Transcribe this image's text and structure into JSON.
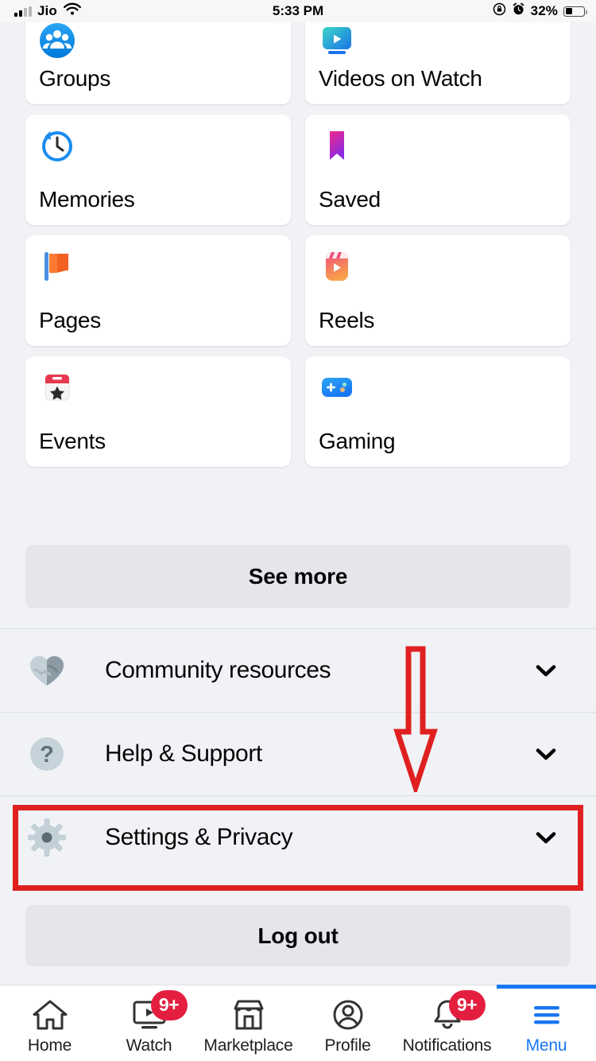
{
  "status_bar": {
    "carrier": "Jio",
    "time": "5:33 PM",
    "battery_percent": "32%",
    "wifi_icon": "wifi-icon",
    "signal_icon": "cellular-signal-icon",
    "rotation_lock_icon": "rotation-lock-icon",
    "alarm_icon": "alarm-clock-icon",
    "battery_icon": "battery-icon"
  },
  "shortcuts": {
    "tiles": [
      {
        "label": "Groups",
        "icon": "groups-icon"
      },
      {
        "label": "Videos on Watch",
        "icon": "watch-video-icon"
      },
      {
        "label": "Memories",
        "icon": "memories-clock-icon"
      },
      {
        "label": "Saved",
        "icon": "saved-bookmark-icon"
      },
      {
        "label": "Pages",
        "icon": "pages-flag-icon"
      },
      {
        "label": "Reels",
        "icon": "reels-clapperboard-icon"
      },
      {
        "label": "Events",
        "icon": "events-calendar-icon"
      },
      {
        "label": "Gaming",
        "icon": "gaming-controller-icon"
      }
    ],
    "see_more_label": "See more"
  },
  "menu_sections": [
    {
      "label": "Community resources",
      "icon": "handshake-heart-icon",
      "chevron": "chevron-down-icon"
    },
    {
      "label": "Help & Support",
      "icon": "question-mark-circle-icon",
      "chevron": "chevron-down-icon"
    },
    {
      "label": "Settings & Privacy",
      "icon": "gear-icon",
      "chevron": "chevron-down-icon",
      "highlighted": true
    }
  ],
  "logout_label": "Log out",
  "annotations": {
    "highlight_color": "#e02020",
    "arrow_color": "#e02020",
    "arrow_direction": "down",
    "highlight_target": "Settings & Privacy"
  },
  "bottom_nav": {
    "active": "Menu",
    "accent_color": "#1877f2",
    "badge_color": "#e41e3f",
    "items": [
      {
        "label": "Home",
        "icon": "home-icon",
        "badge": ""
      },
      {
        "label": "Watch",
        "icon": "watch-icon",
        "badge": "9+"
      },
      {
        "label": "Marketplace",
        "icon": "marketplace-icon",
        "badge": ""
      },
      {
        "label": "Profile",
        "icon": "profile-icon",
        "badge": ""
      },
      {
        "label": "Notifications",
        "icon": "bell-icon",
        "badge": "9+"
      },
      {
        "label": "Menu",
        "icon": "hamburger-menu-icon",
        "badge": ""
      }
    ]
  }
}
